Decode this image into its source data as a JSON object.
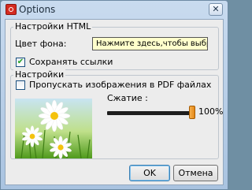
{
  "window": {
    "title": "Options",
    "close_glyph": "✕"
  },
  "html_group": {
    "legend": "Настройки HTML",
    "bg_color_label": "Цвет фона:",
    "bg_color_prompt": "Нажмите здесь,чтобы выбрать.",
    "save_links": {
      "label": "Сохранять ссылки",
      "checked": true
    }
  },
  "settings_group": {
    "legend": "Настройки",
    "skip_images": {
      "label": "Пропускать изображения в PDF файлах",
      "checked": false
    },
    "compression": {
      "label": "Сжатие :",
      "value_text": "100%",
      "value": 1.0
    }
  },
  "buttons": {
    "ok": "OK",
    "cancel": "Отмена"
  },
  "colors": {
    "tooltip_bg": "#ffffcc",
    "slider_thumb": "#f0a030",
    "dialog_bg": "#ececec"
  }
}
